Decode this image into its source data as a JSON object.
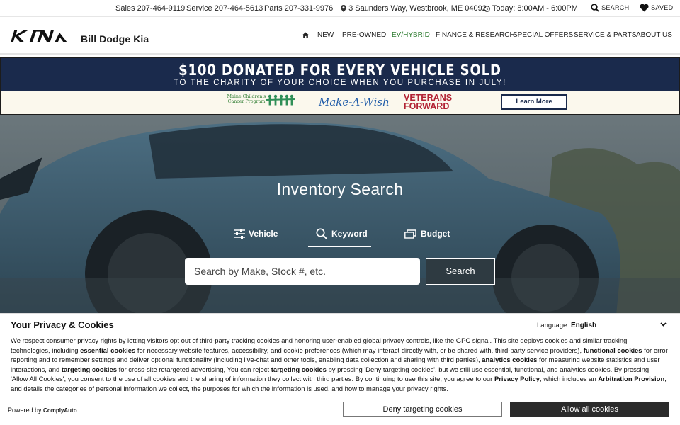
{
  "topbar": {
    "sales": "Sales 207-464-9119",
    "service": "Service 207-464-5613",
    "parts": "Parts 207-331-9976",
    "address": "3 Saunders Way, Westbrook, ME 04092",
    "hours": "Today: 8:00AM - 6:00PM",
    "search": "SEARCH",
    "saved": "SAVED"
  },
  "header": {
    "dealer_name": "Bill Dodge Kia",
    "nav": [
      "NEW",
      "PRE-OWNED",
      "EV/HYBRID",
      "FINANCE & RESEARCH",
      "SPECIAL OFFERS",
      "SERVICE & PARTS",
      "ABOUT US"
    ]
  },
  "banner": {
    "headline": "$100 DONATED FOR EVERY VEHICLE SOLD",
    "subline": "TO THE CHARITY OF YOUR CHOICE WHEN YOU PURCHASE IN JULY!",
    "logos": [
      "Maine Children's Cancer Program",
      "Make-A-Wish",
      "VETERANS FORWARD"
    ],
    "cta": "Learn More"
  },
  "hero": {
    "title": "Inventory Search",
    "tabs": [
      "Vehicle",
      "Keyword",
      "Budget"
    ],
    "active_tab": "Keyword",
    "search_placeholder": "Search by Make, Stock #, etc.",
    "search_button": "Search"
  },
  "privacy": {
    "title": "Your Privacy & Cookies",
    "language_label": "Language:",
    "language_value": "English",
    "powered_by": "Powered by",
    "powered_brand": "ComplyAuto",
    "deny_button": "Deny targeting cookies",
    "allow_button": "Allow all cookies",
    "p1": "We respect consumer privacy rights by letting visitors opt out of third-party tracking cookies and honoring user-enabled global privacy controls, like the GPC signal. This site deploys cookies and similar tracking technologies, including ",
    "b1": "essential cookies",
    "p2": " for necessary website features, accessibility, and cookie preferences (which may interact directly with, or be shared with, third-party service providers), ",
    "b2": "functional cookies",
    "p3": " for error reporting and to remember settings and deliver optional functionality (including live-chat and other tools, enabling data collection and sharing with third parties), ",
    "b3": "analytics cookies",
    "p4": " for measuring website statistics and user interactions, and ",
    "b4": "targeting cookies",
    "p5": " for cross-site retargeted advertising, You can reject ",
    "b5": "targeting cookies",
    "p6": " by pressing 'Deny targeting cookies', but we still use essential, functional, and analytics cookies. By pressing 'Allow All Cookies', you consent to the use of all cookies and the sharing of information they collect with third parties. By continuing to use this site, you agree to our ",
    "link": "Privacy Policy",
    "p7": ", which includes an ",
    "b6": "Arbitration Provision",
    "p8": ", and details the categories of personal information we collect, the purposes for which the information is used, and how to manage your privacy rights."
  },
  "colors": {
    "navy": "#1a2a4c",
    "ev_green": "#2f7d32",
    "allow_bg": "#2b2b2b"
  },
  "icons": [
    "map-pin-icon",
    "clock-icon",
    "search-icon",
    "heart-icon",
    "home-icon",
    "sliders-icon",
    "cards-icon",
    "chevron-down-icon"
  ]
}
